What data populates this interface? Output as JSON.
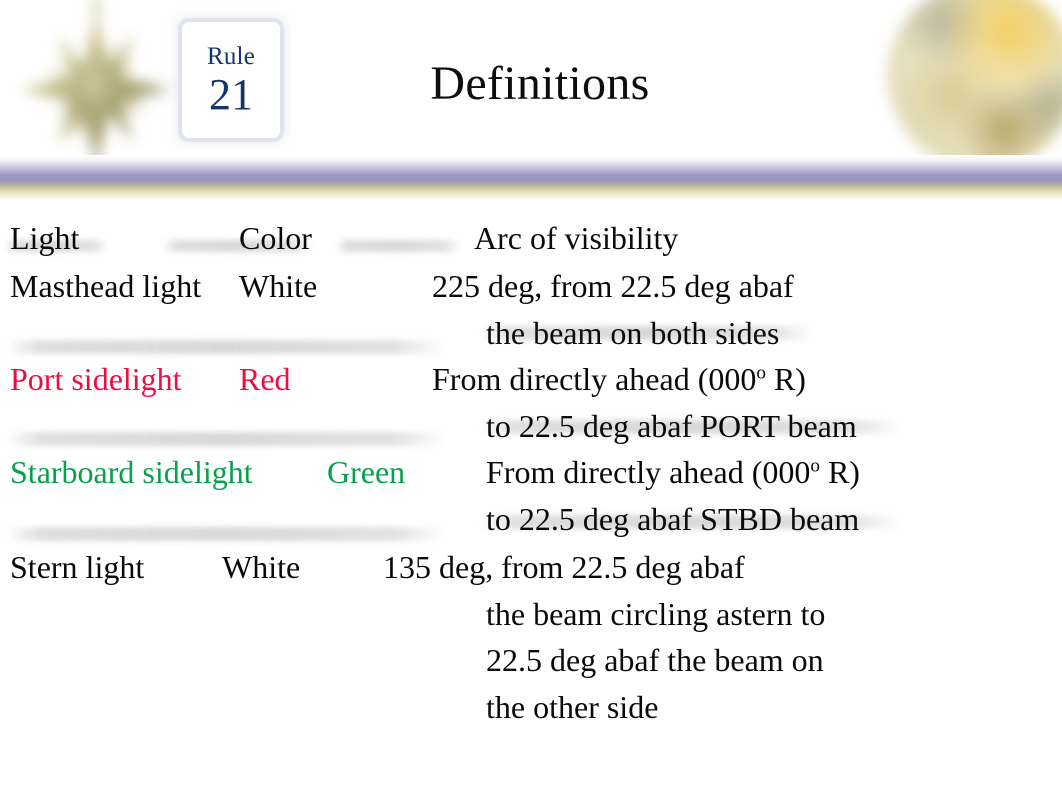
{
  "header": {
    "rule_word": "Rule",
    "rule_number": "21",
    "title": "Definitions",
    "accent_navy": "#14356b",
    "band_lavender": "#9a97c0",
    "band_khaki": "#e8e6c8"
  },
  "colors": {
    "text": "#0a0a0a",
    "port_red": "#ef0c3f",
    "starboard_green": "#06a14d"
  },
  "table": {
    "headers": {
      "light": "Light",
      "color": "Color",
      "arc": "Arc of visibility"
    },
    "rows": [
      {
        "light": "Masthead light",
        "color": "White",
        "arc_lines": [
          "225 deg, from 22.5 deg abaf",
          "the beam on both sides"
        ],
        "text_color": "#0a0a0a"
      },
      {
        "light": "Port sidelight",
        "color": "Red",
        "arc_lines": [
          "From directly ahead (000º R)",
          "to 22.5 deg abaf PORT beam"
        ],
        "text_color": "#ef0c3f"
      },
      {
        "light": "Starboard sidelight",
        "color": "Green",
        "arc_lines": [
          "From directly ahead (000º R)",
          "to 22.5 deg abaf STBD beam"
        ],
        "text_color": "#06a14d"
      },
      {
        "light": "Stern light",
        "color": "White",
        "arc_lines": [
          "135 deg, from 22.5 deg abaf",
          "the beam circling astern to",
          "22.5 deg abaf the beam on",
          "the other side"
        ],
        "text_color": "#0a0a0a"
      }
    ]
  },
  "lines": {
    "head_light": "Light",
    "head_color": "Color",
    "head_arc": "Arc of visibility",
    "r1_light": "Masthead light",
    "r1_color": "White",
    "r1_arc1": "225 deg, from 22.5 deg abaf",
    "r1_arc2": "the beam on both sides",
    "r2_light": "Port sidelight",
    "r2_color": "Red",
    "r2_arc1a": "From directly ahead (000",
    "r2_arc1b": "o",
    "r2_arc1c": " R)",
    "r2_arc2": "to 22.5 deg abaf PORT beam",
    "r3_light": "Starboard sidelight",
    "r3_color": "Green",
    "r3_arc1a": "From directly ahead (000",
    "r3_arc1b": "o",
    "r3_arc1c": " R)",
    "r3_arc2": "to 22.5 deg abaf STBD beam",
    "r4_light": "Stern light",
    "r4_color": "White",
    "r4_arc1": "135 deg, from 22.5 deg abaf",
    "r4_arc2": "the beam circling astern to",
    "r4_arc3": "22.5 deg abaf the beam on",
    "r4_arc4": "the other side"
  },
  "icons": {
    "compass_rose": "compass-rose-icon",
    "medallion": "gold-medallion-icon"
  }
}
